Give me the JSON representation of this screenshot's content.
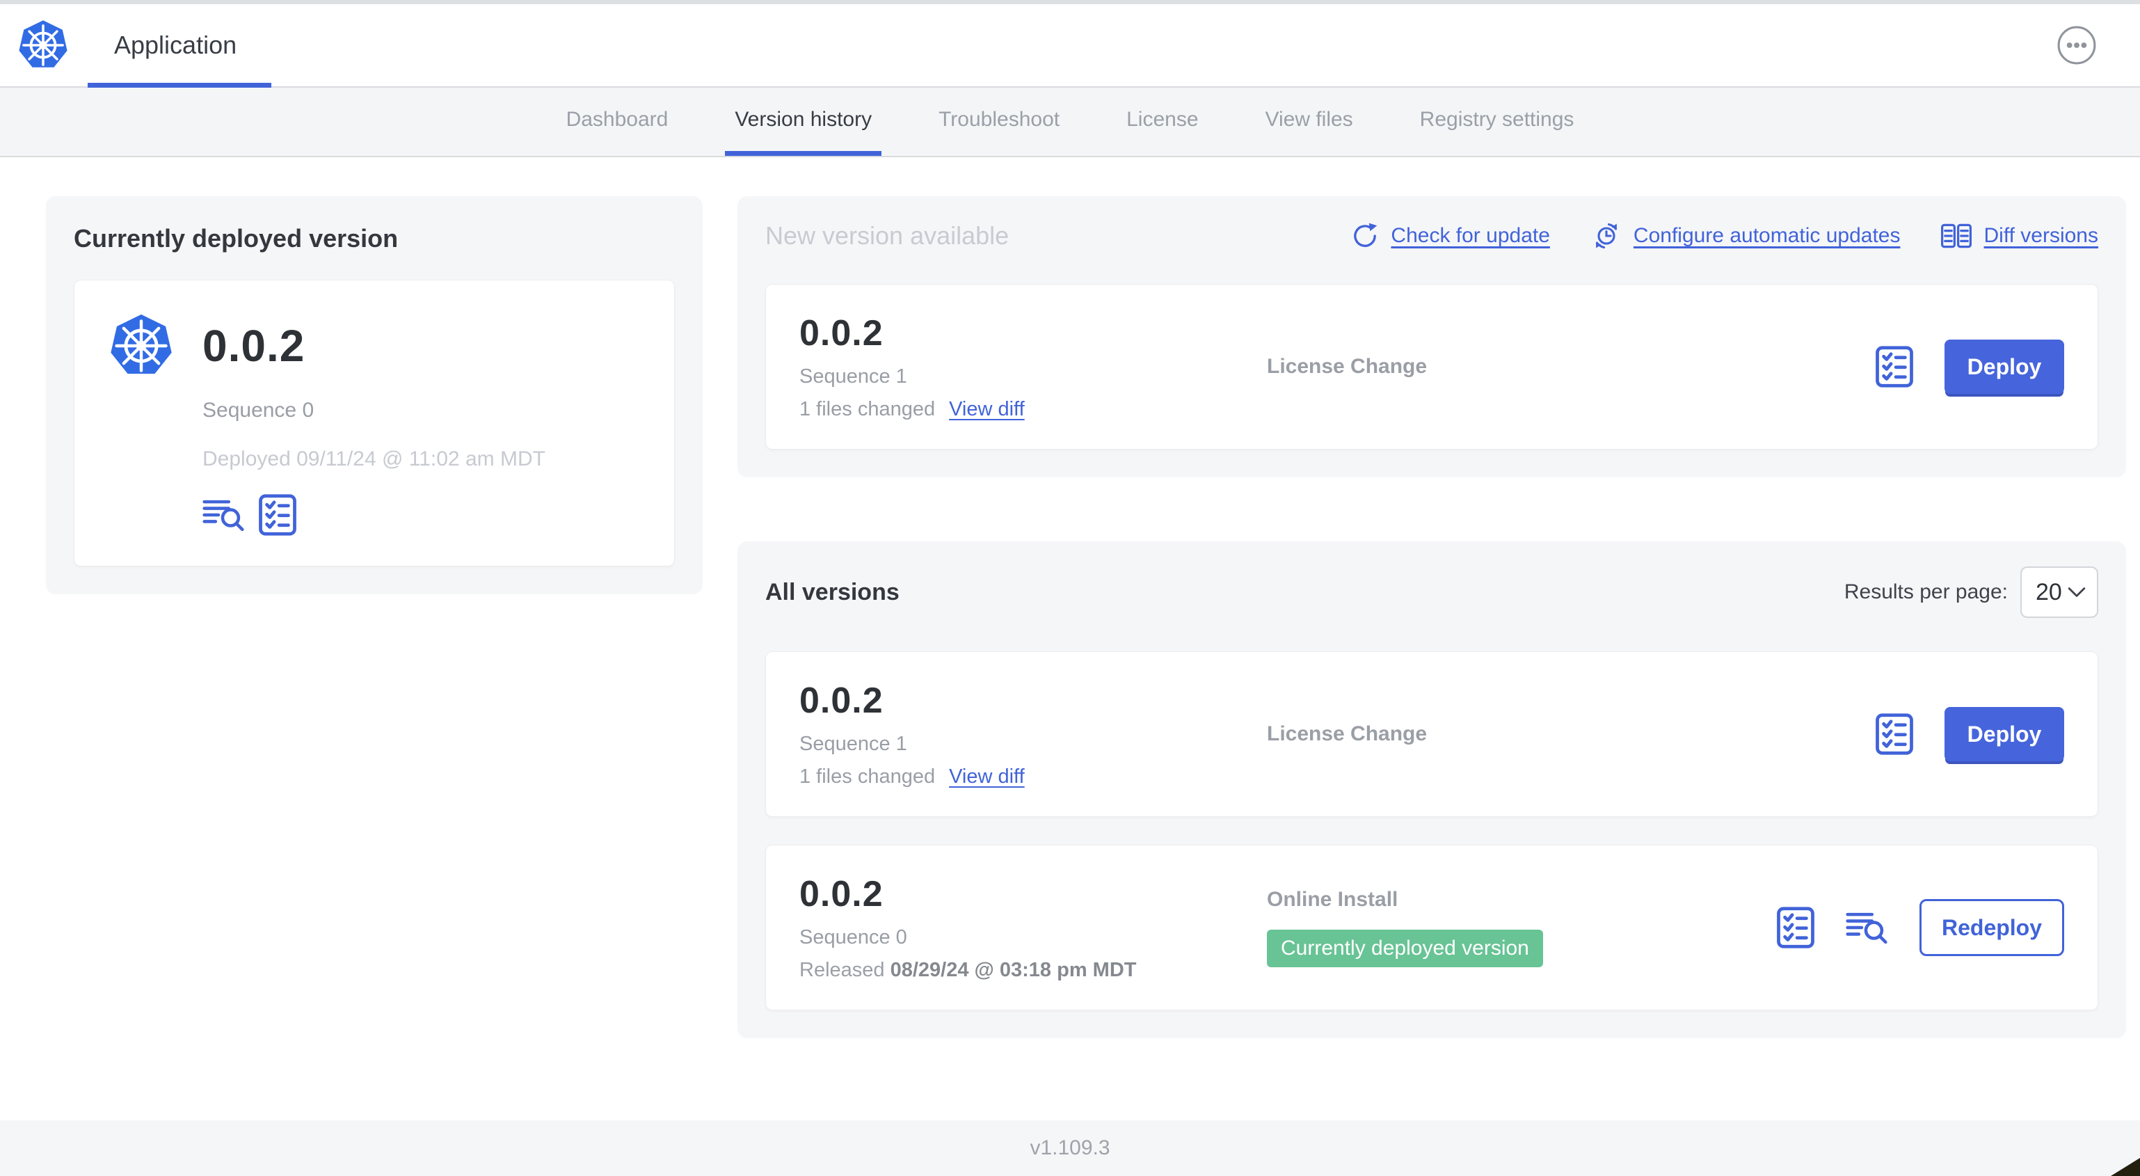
{
  "header": {
    "app_title": "Application"
  },
  "nav": {
    "tabs": [
      {
        "label": "Dashboard",
        "active": false
      },
      {
        "label": "Version history",
        "active": true
      },
      {
        "label": "Troubleshoot",
        "active": false
      },
      {
        "label": "License",
        "active": false
      },
      {
        "label": "View files",
        "active": false
      },
      {
        "label": "Registry settings",
        "active": false
      }
    ]
  },
  "currently_deployed": {
    "title": "Currently deployed version",
    "version": "0.0.2",
    "sequence": "Sequence 0",
    "deployed_at": "Deployed 09/11/24 @ 11:02 am MDT"
  },
  "new_version": {
    "title": "New version available",
    "actions": [
      {
        "label": "Check for update",
        "icon": "rotate-ccw-icon"
      },
      {
        "label": "Configure automatic updates",
        "icon": "sync-clock-icon"
      },
      {
        "label": "Diff versions",
        "icon": "diff-icon"
      }
    ],
    "card": {
      "version": "0.0.2",
      "sequence": "Sequence 1",
      "files_changed": "1 files changed",
      "view_diff_label": "View diff",
      "source": "License Change",
      "deploy_label": "Deploy"
    }
  },
  "all_versions": {
    "title": "All versions",
    "results_per_page_label": "Results per page:",
    "results_per_page_value": "20",
    "rows": [
      {
        "version": "0.0.2",
        "sequence": "Sequence 1",
        "files_changed": "1 files changed",
        "view_diff_label": "View diff",
        "source": "License Change",
        "action_label": "Deploy"
      },
      {
        "version": "0.0.2",
        "sequence": "Sequence 0",
        "released_prefix": "Released ",
        "released_date": "08/29/24 @ 03:18 pm MDT",
        "source": "Online Install",
        "badge": "Currently deployed version",
        "action_label": "Redeploy"
      }
    ]
  },
  "footer": {
    "version": "v1.109.3"
  },
  "colors": {
    "accent_blue": "#4163d9",
    "button_blue": "#4665dc",
    "kubernetes_blue": "#326ce5",
    "badge_green": "#68c395",
    "section_gray": "#f5f6f8"
  }
}
